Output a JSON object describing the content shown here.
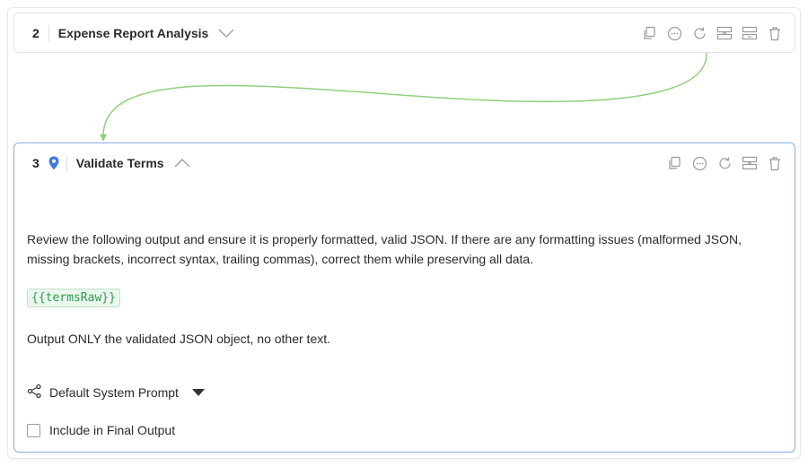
{
  "steps": [
    {
      "number": "2",
      "title": "Expense Report Analysis",
      "state": "collapsed",
      "actions": [
        "copy-icon",
        "more-icon",
        "refresh-icon",
        "split-top-icon",
        "split-bottom-icon",
        "trash-icon"
      ]
    },
    {
      "number": "3",
      "title": "Validate Terms",
      "state": "expanded",
      "actions": [
        "copy-icon",
        "more-icon",
        "refresh-icon",
        "split-icon",
        "trash-icon"
      ],
      "prompt_line_1": "Review the following output and ensure it is properly formatted, valid JSON. If there are any formatting issues (malformed JSON, missing brackets, incorrect syntax, trailing commas), correct them while preserving all data.",
      "variable": "{{termsRaw}}",
      "prompt_line_2": "Output ONLY the validated JSON object, no other text.",
      "system_prompt_label": "Default System Prompt",
      "include_label": "Include in Final Output",
      "include_checked": false
    }
  ],
  "colors": {
    "connector": "#8fd07a",
    "expanded_border": "#8aaee6",
    "pin": "#3b7be8",
    "variable_text": "#2e9a52",
    "variable_bg": "#eaf7ee"
  }
}
